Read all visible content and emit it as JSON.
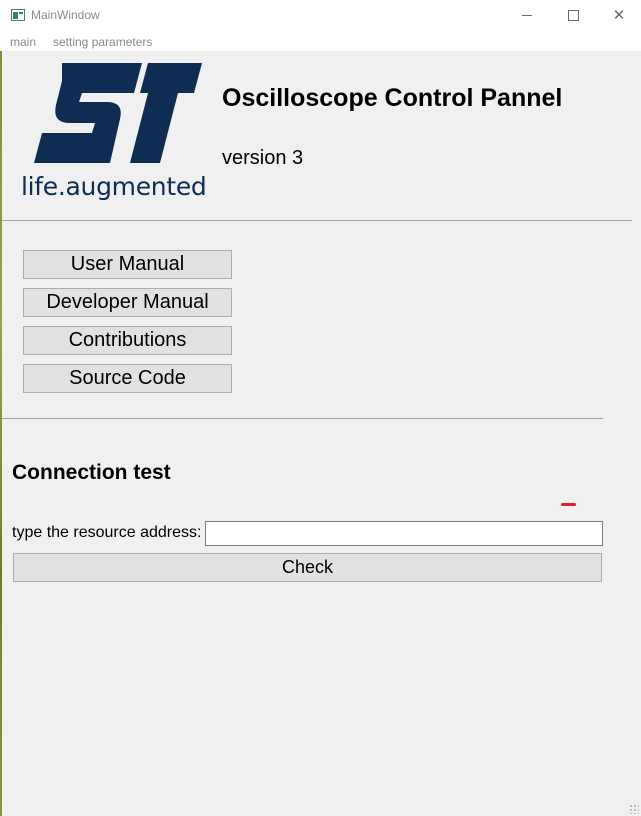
{
  "window": {
    "title": "MainWindow",
    "minimize_icon": "minimize-icon",
    "maximize_icon": "maximize-icon",
    "close_glyph": "✕"
  },
  "menu": {
    "items": [
      "main",
      "setting parameters"
    ]
  },
  "header": {
    "logo_tagline": "life.augmented",
    "app_title": "Oscilloscope Control Pannel",
    "version": "version 3",
    "brand_color": "#0f2d52"
  },
  "docs": {
    "buttons": [
      "User Manual",
      "Developer Manual",
      "Contributions",
      "Source Code"
    ]
  },
  "connection": {
    "section_title": "Connection test",
    "address_label": "type the resource address:",
    "address_value": "",
    "check_label": "Check"
  },
  "colors": {
    "window_bg": "#f0f0f0",
    "button_bg": "#e1e1e1",
    "mark": "#e0202a"
  }
}
